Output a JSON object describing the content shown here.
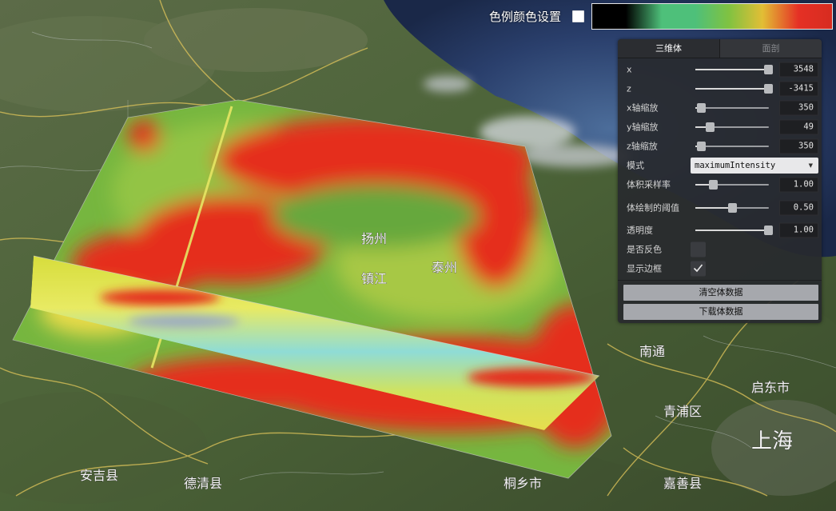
{
  "legend": {
    "label": "色例颜色设置",
    "checked": false,
    "gradient": [
      "#000000",
      "#000000",
      "#4ec07a",
      "#4ec07a",
      "#80c241",
      "#e2be35",
      "#e53025",
      "#d72c20"
    ]
  },
  "panel": {
    "tabs": [
      {
        "label": "三维体",
        "active": true
      },
      {
        "label": "面剖",
        "active": false
      }
    ],
    "x": {
      "label": "x",
      "value": "3548",
      "fraction": 0.99
    },
    "z": {
      "label": "z",
      "value": "-3415",
      "fraction": 0.99
    },
    "x_scale": {
      "label": "x轴缩放",
      "value": "350",
      "fraction": 0.08
    },
    "y_scale": {
      "label": "y轴缩放",
      "value": "49",
      "fraction": 0.2
    },
    "z_scale": {
      "label": "z轴缩放",
      "value": "350",
      "fraction": 0.08
    },
    "mode": {
      "label": "模式",
      "value": "maximumIntensity"
    },
    "sample_rate": {
      "label": "体积采样率",
      "value": "1.00",
      "fraction": 0.24
    },
    "threshold": {
      "label": "体绘制的阈值",
      "value": "0.50",
      "fraction": 0.5
    },
    "opacity": {
      "label": "透明度",
      "value": "1.00",
      "fraction": 0.99
    },
    "invert": {
      "label": "是否反色",
      "checked": false
    },
    "show_border": {
      "label": "显示边框",
      "checked": true
    },
    "clear_button": "清空体数据",
    "download_button": "下载体数据"
  },
  "map": {
    "places": [
      "扬州",
      "镇江",
      "泰州",
      "南通",
      "上海",
      "启东市",
      "青浦区",
      "嘉善县",
      "桐乡市",
      "德清县",
      "安吉县"
    ]
  },
  "colors": {
    "panel_bg": "#28292d",
    "heat_red": "#e52d1e",
    "heat_yellow": "#d8d84a",
    "heat_cyan": "#8fdcd6"
  }
}
